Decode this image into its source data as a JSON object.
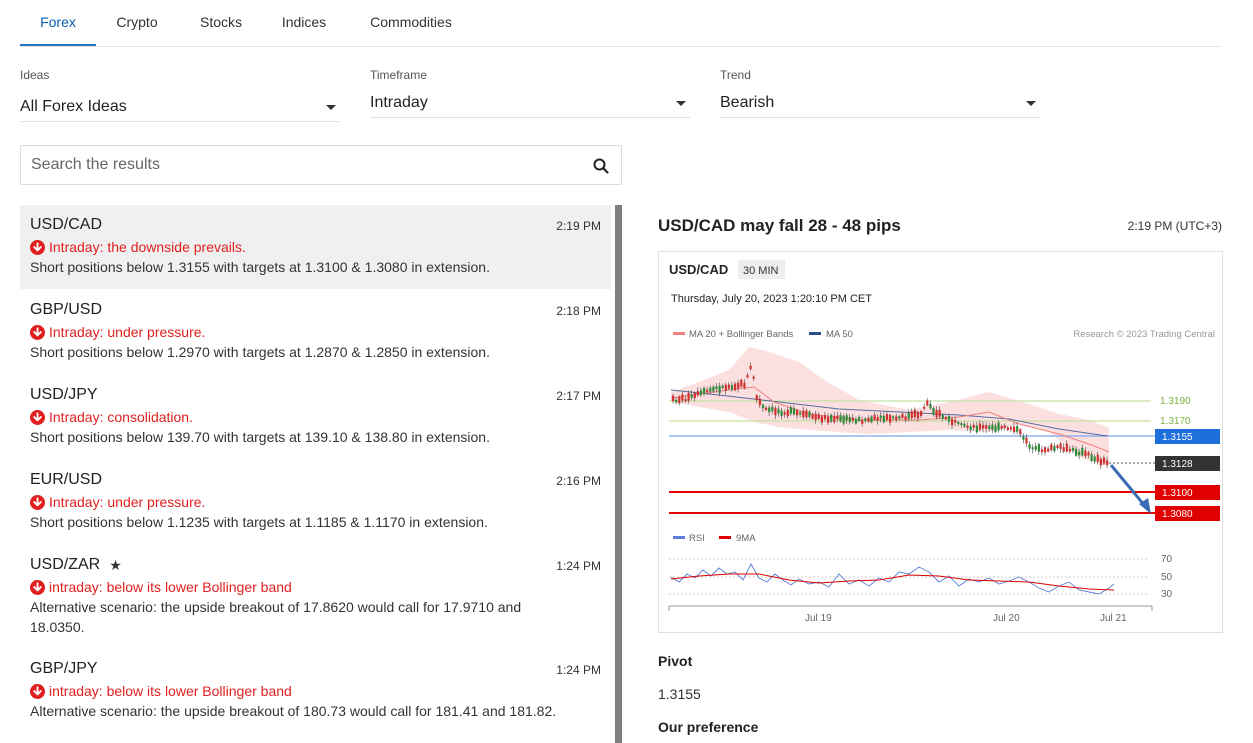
{
  "tabs": [
    {
      "label": "Forex",
      "active": true
    },
    {
      "label": "Crypto",
      "active": false
    },
    {
      "label": "Stocks",
      "active": false
    },
    {
      "label": "Indices",
      "active": false
    },
    {
      "label": "Commodities",
      "active": false
    }
  ],
  "filters": {
    "ideas": {
      "label": "Ideas",
      "value": "All Forex Ideas"
    },
    "timeframe": {
      "label": "Timeframe",
      "value": "Intraday"
    },
    "trend": {
      "label": "Trend",
      "value": "Bearish"
    }
  },
  "search": {
    "placeholder": "Search the results",
    "value": ""
  },
  "results": [
    {
      "pair": "USD/CAD",
      "time": "2:19 PM",
      "trend": "Intraday: the downside prevails.",
      "desc": "Short positions below 1.3155 with targets at 1.3100 & 1.3080 in extension.",
      "selected": true,
      "starred": false
    },
    {
      "pair": "GBP/USD",
      "time": "2:18 PM",
      "trend": "Intraday: under pressure.",
      "desc": "Short positions below 1.2970 with targets at 1.2870 & 1.2850 in extension.",
      "selected": false,
      "starred": false
    },
    {
      "pair": "USD/JPY",
      "time": "2:17 PM",
      "trend": "Intraday: consolidation.",
      "desc": "Short positions below 139.70 with targets at 139.10 & 138.80 in extension.",
      "selected": false,
      "starred": false
    },
    {
      "pair": "EUR/USD",
      "time": "2:16 PM",
      "trend": "Intraday: under pressure.",
      "desc": "Short positions below 1.1235 with targets at 1.1185 & 1.1170 in extension.",
      "selected": false,
      "starred": false
    },
    {
      "pair": "USD/ZAR",
      "time": "1:24 PM",
      "trend": "intraday: below its lower Bollinger band",
      "desc": "Alternative scenario: the upside breakout of 17.8620 would call for 17.9710 and 18.0350.",
      "selected": false,
      "starred": true
    },
    {
      "pair": "GBP/JPY",
      "time": "1:24 PM",
      "trend": "intraday: below its lower Bollinger band",
      "desc": "Alternative scenario: the upside breakout of 180.73 would call for 181.41 and 181.82.",
      "selected": false,
      "starred": false
    }
  ],
  "detail": {
    "title": "USD/CAD may fall 28 - 48 pips",
    "time": "2:19 PM (UTC+3)",
    "pivot_label": "Pivot",
    "pivot_value": "1.3155",
    "preference_label": "Our preference"
  },
  "chart": {
    "symbol": "USD/CAD",
    "interval": "30 MIN",
    "datetime": "Thursday, July 20, 2023 1:20:10 PM CET",
    "legend": [
      {
        "label": "MA 20 + Bollinger Bands",
        "color": "#f08080"
      },
      {
        "label": "MA 50",
        "color": "#2c4f8f"
      }
    ],
    "rsi_legend": [
      {
        "label": "RSI",
        "color": "#5b7fd8"
      },
      {
        "label": "9MA",
        "color": "#e00000"
      }
    ],
    "copyright": "Research © 2023 Trading Central",
    "levels": [
      {
        "label": "1.3190",
        "kind": "resistance",
        "color": "#7cb342"
      },
      {
        "label": "1.3170",
        "kind": "resistance",
        "color": "#7cb342"
      },
      {
        "label": "1.3155",
        "kind": "pivot",
        "color": "#1e6fd9"
      },
      {
        "label": "1.3128",
        "kind": "last",
        "color": "#333333"
      },
      {
        "label": "1.3100",
        "kind": "target",
        "color": "#e00000"
      },
      {
        "label": "1.3080",
        "kind": "target",
        "color": "#e00000"
      }
    ],
    "rsi_levels": [
      "70",
      "50",
      "30"
    ],
    "x_labels": [
      "Jul 19",
      "Jul 20",
      "Jul 21"
    ]
  }
}
